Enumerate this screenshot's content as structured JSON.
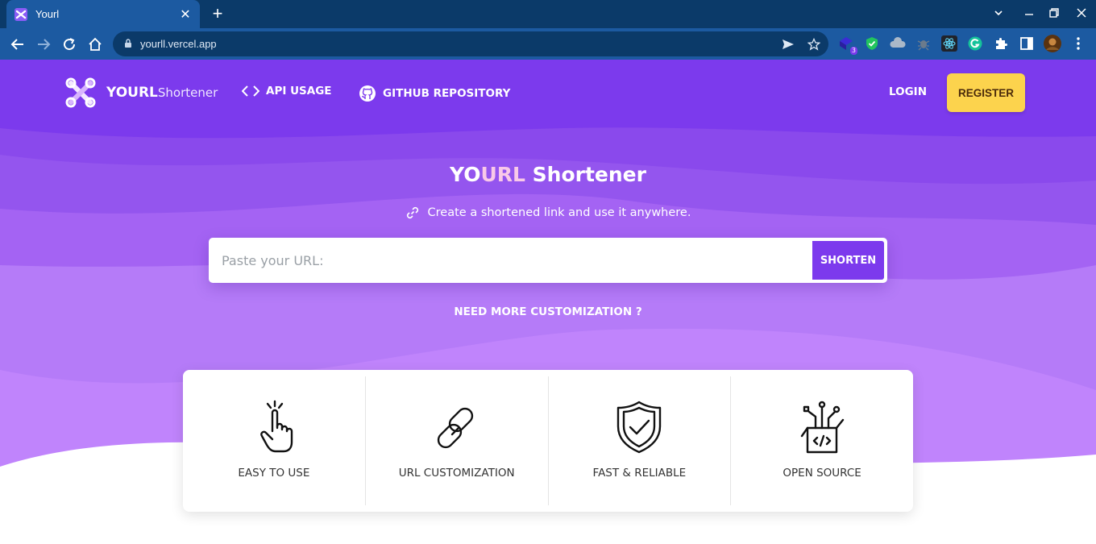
{
  "browser": {
    "tab_title": "Yourl",
    "tab_close": "✕",
    "new_tab": "+",
    "url": "yourll.vercel.app",
    "extension_badge": "3",
    "window_controls": {
      "dropdown": "⌄",
      "minimize": "—",
      "restore": "❐",
      "close": "✕"
    }
  },
  "nav": {
    "logo_strong": "YOURL",
    "logo_light": "Shortener",
    "api_usage": "API USAGE",
    "github": "GITHUB REPOSITORY",
    "login": "LOGIN",
    "register": "REGISTER"
  },
  "hero": {
    "title_part1": "YO",
    "title_highlight": "URL",
    "title_part2": " Shortener",
    "subtitle": "Create a shortened link and use it anywhere.",
    "input_placeholder": "Paste your URL:",
    "shorten_label": "SHORTEN",
    "customize_link": "NEED MORE CUSTOMIZATION ?"
  },
  "features": [
    {
      "label": "EASY TO USE",
      "icon": "hand-pointer-icon"
    },
    {
      "label": "URL CUSTOMIZATION",
      "icon": "chain-link-icon"
    },
    {
      "label": "FAST & RELIABLE",
      "icon": "shield-check-icon"
    },
    {
      "label": "OPEN SOURCE",
      "icon": "code-box-icon"
    }
  ],
  "colors": {
    "brand_purple": "#7c3aed",
    "register_yellow": "#fcd34d",
    "chrome_dark": "#0b3a69",
    "chrome_light": "#1c5aa1"
  }
}
